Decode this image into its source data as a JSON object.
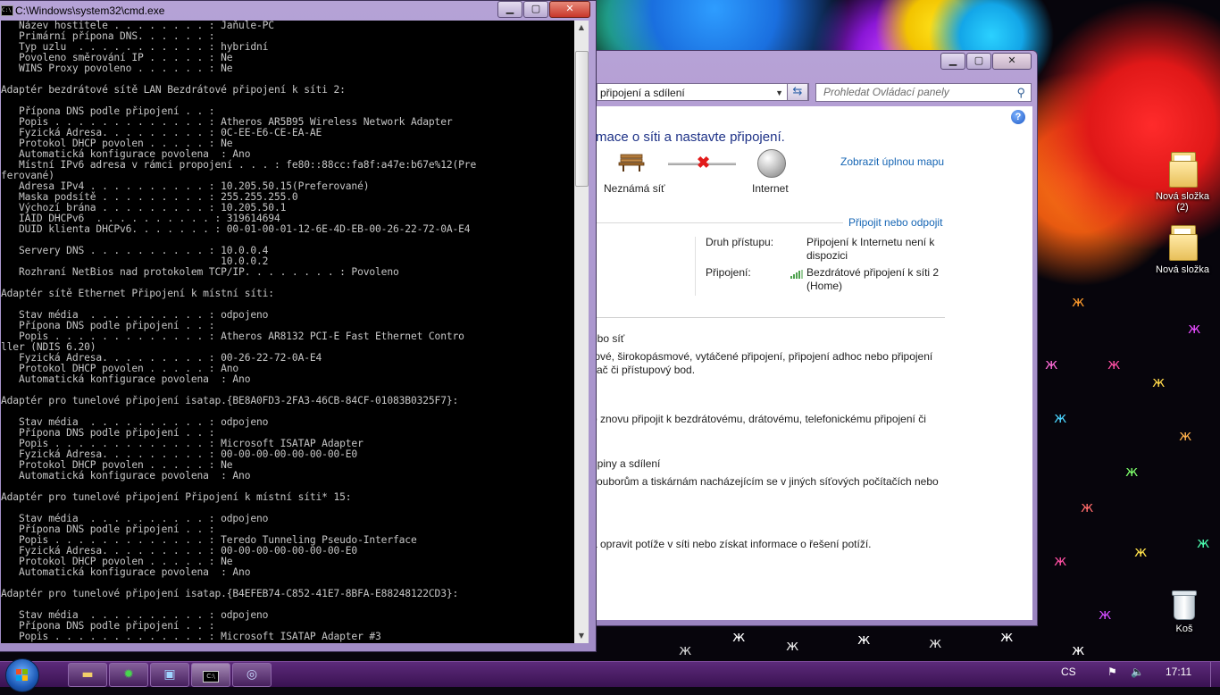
{
  "cmd": {
    "title": "C:\\Windows\\system32\\cmd.exe",
    "lines": [
      "   Název hostitele . . . . . . . . : Jaňule-PC",
      "   Primární přípona DNS. . . . . . :",
      "   Typ uzlu  . . . . . . . . . . . : hybridní",
      "   Povoleno směrování IP . . . . . : Ne",
      "   WINS Proxy povoleno . . . . . . : Ne",
      "",
      "Adaptér bezdrátové sítě LAN Bezdrátové připojení k síti 2:",
      "",
      "   Přípona DNS podle připojení . . :",
      "   Popis . . . . . . . . . . . . . : Atheros AR5B95 Wireless Network Adapter",
      "   Fyzická Adresa. . . . . . . . . : 0C-EE-E6-CE-EA-AE",
      "   Protokol DHCP povolen . . . . . : Ne",
      "   Automatická konfigurace povolena  : Ano",
      "   Místní IPv6 adresa v rámci propojení . . . : fe80::88cc:fa8f:a47e:b67e%12(Pre",
      "ferované)",
      "   Adresa IPv4 . . . . . . . . . . : 10.205.50.15(Preferované)",
      "   Maska podsítě . . . . . . . . . : 255.255.255.0",
      "   Výchozí brána . . . . . . . . . : 10.205.50.1",
      "   IAID DHCPv6  . . . . . . . . . . : 319614694",
      "   DUID klienta DHCPv6. . . . . . . : 00-01-00-01-12-6E-4D-EB-00-26-22-72-0A-E4",
      "",
      "   Servery DNS . . . . . . . . . . : 10.0.0.4",
      "                                     10.0.0.2",
      "   Rozhraní NetBios nad protokolem TCP/IP. . . . . . . . : Povoleno",
      "",
      "Adaptér sítě Ethernet Připojení k místní síti:",
      "",
      "   Stav média  . . . . . . . . . . : odpojeno",
      "   Přípona DNS podle připojení . . :",
      "   Popis . . . . . . . . . . . . . : Atheros AR8132 PCI-E Fast Ethernet Contro",
      "ller (NDIS 6.20)",
      "   Fyzická Adresa. . . . . . . . . : 00-26-22-72-0A-E4",
      "   Protokol DHCP povolen . . . . . : Ano",
      "   Automatická konfigurace povolena  : Ano",
      "",
      "Adaptér pro tunelové připojení isatap.{BE8A0FD3-2FA3-46CB-84CF-01083B0325F7}:",
      "",
      "   Stav média  . . . . . . . . . . : odpojeno",
      "   Přípona DNS podle připojení . . :",
      "   Popis . . . . . . . . . . . . . : Microsoft ISATAP Adapter",
      "   Fyzická Adresa. . . . . . . . . : 00-00-00-00-00-00-00-E0",
      "   Protokol DHCP povolen . . . . . : Ne",
      "   Automatická konfigurace povolena  : Ano",
      "",
      "Adaptér pro tunelové připojení Připojení k místní síti* 15:",
      "",
      "   Stav média  . . . . . . . . . . : odpojeno",
      "   Přípona DNS podle připojení . . :",
      "   Popis . . . . . . . . . . . . . : Teredo Tunneling Pseudo-Interface",
      "   Fyzická Adresa. . . . . . . . . : 00-00-00-00-00-00-00-E0",
      "   Protokol DHCP povolen . . . . . : Ne",
      "   Automatická konfigurace povolena  : Ano",
      "",
      "Adaptér pro tunelové připojení isatap.{B4EFEB74-C852-41E7-8BFA-E88248122CD3}:",
      "",
      "   Stav média  . . . . . . . . . . : odpojeno",
      "   Přípona DNS podle připojení . . :",
      "   Popis . . . . . . . . . . . . . : Microsoft ISATAP Adapter #3"
    ]
  },
  "control_panel": {
    "address_text": "připojení a sdílení",
    "search_placeholder": "Prohledat Ovládací panely",
    "heading": "rmace o síti a nastavte připojení.",
    "full_map_link": "Zobrazit úplnou mapu",
    "unknown_network": "Neznámá síť",
    "internet_label": "Internet",
    "connect_disconnect_link": "Připojit nebo odpojit",
    "access_type_label": "Druh přístupu:",
    "access_type_value_1": "Připojení k Internetu není k",
    "access_type_value_2": "dispozici",
    "connections_label": "Připojení:",
    "connection_link_1": "Bezdrátové připojení k síti 2",
    "connection_link_2": "(Home)",
    "task1_link": "ebo síť",
    "task1_text_1": "tové, širokopásmové, vytáčené připojení, připojení adhoc nebo připojení",
    "task1_text_2": "vač či přístupový bod.",
    "task2_text": "o znovu připojit k bezdrátovému, drátovému, telefonickému připojení či",
    "task3_link": "upiny a sdílení",
    "task3_text": "souborům a tiskárnám nacházejícím se v jiných síťových počítačích nebo",
    "task4_text": "a opravit potíže v síti nebo získat informace o řešení potíží.",
    "help_label": "?"
  },
  "desktop": {
    "icons": [
      {
        "label": "Nová složka",
        "sub": "(2)"
      },
      {
        "label": "Nová složka",
        "sub": ""
      },
      {
        "label": "Koš",
        "sub": ""
      }
    ]
  },
  "taskbar": {
    "language": "CS",
    "clock": "17:11"
  },
  "colors": {
    "link": "#1565b4",
    "heading": "#1e3287",
    "console_text": "#c6c6c6",
    "taskbar": "#4a1a66"
  }
}
